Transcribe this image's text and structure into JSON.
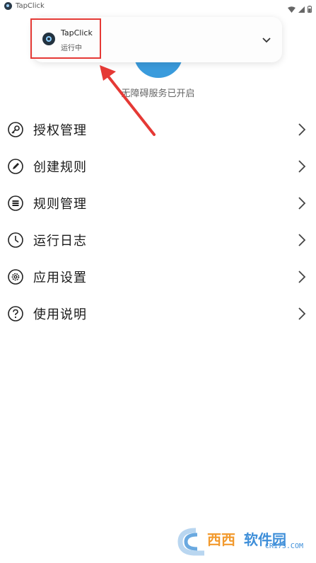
{
  "statusbar": {
    "app_title": "TapClick"
  },
  "header": {
    "service_status": "无障碍服务已开启"
  },
  "notification": {
    "title": "TapClick",
    "subtitle": "运行中"
  },
  "menu": {
    "items": [
      {
        "label": "授权管理",
        "icon": "key-icon"
      },
      {
        "label": "创建规则",
        "icon": "pencil-icon"
      },
      {
        "label": "规则管理",
        "icon": "list-icon"
      },
      {
        "label": "运行日志",
        "icon": "clock-icon"
      },
      {
        "label": "应用设置",
        "icon": "gear-icon"
      },
      {
        "label": "使用说明",
        "icon": "help-icon"
      }
    ]
  },
  "watermark": {
    "brand": "西西软件园",
    "site": "CR173.COM"
  },
  "colors": {
    "accent": "#3a9bdc",
    "highlight": "#e53935"
  }
}
